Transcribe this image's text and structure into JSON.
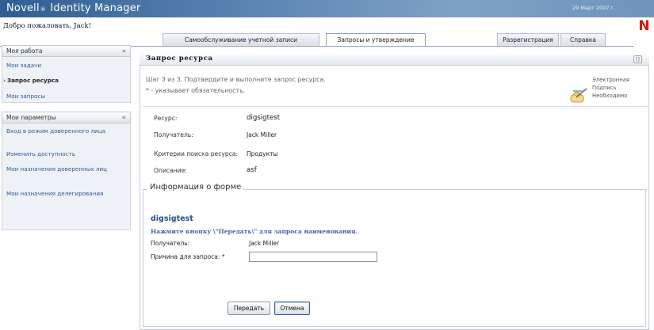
{
  "app": {
    "brand_prefix": "Novell",
    "brand_reg": "®",
    "brand_suffix": "Identity Manager",
    "date": "29 Март 2007 г.",
    "vendor_logo": "N",
    "welcome": "Добро пожаловать, Jack!"
  },
  "tabs": {
    "self_service": "Самообслуживание учетной записи",
    "requests": "Запросы и утверждение",
    "logout": "Разрегистрация",
    "help": "Справка",
    "active": "requests"
  },
  "sidebar": {
    "work": {
      "header": "Моя работа",
      "items": [
        "Мои задачи",
        "Запрос ресурса",
        "Мои запросы"
      ],
      "current_index": 1
    },
    "settings": {
      "header": "Мои параметры",
      "items": [
        "Вход в режим доверенного лица",
        "Изменить доступность",
        "Мои назначения доверенных лиц",
        "Мои назначения делегирования"
      ]
    },
    "collapse_glyph": "«"
  },
  "panel": {
    "title": "Запрос ресурса",
    "step_text": "Шаг 3 из 3. Подтвердите и выполните запрос ресурса.",
    "required_text": "* - указывает обязательность.",
    "esig": {
      "line1": "Электронная",
      "line2": "Подпись",
      "line3": "Необходимо",
      "icon": "signature-pen-icon"
    },
    "fields": [
      {
        "label": "Ресурс:",
        "value": "digsigtest"
      },
      {
        "label": "Получатель:",
        "value": "Jack Miller"
      },
      {
        "label": "Критерии поиска ресурса:",
        "value": "Продукты"
      },
      {
        "label": "Описание:",
        "value": "asf"
      }
    ]
  },
  "form": {
    "legend": "Информация о форме",
    "title": "digsigtest",
    "instruction": "Нажмите кнопку \\\"Передать\\\" для запроса наименования.",
    "recipient_label": "Получатель:",
    "recipient_value": "Jack Miller",
    "reason_label": "Причина для запроса:",
    "required_mark": "*",
    "reason_value": "",
    "submit": "Передать",
    "cancel": "Отмена"
  },
  "colors": {
    "header_blue": "#2f5e93",
    "link": "#2f5b94",
    "form_title": "#2f4f86",
    "vendor_red": "#e3120b"
  }
}
